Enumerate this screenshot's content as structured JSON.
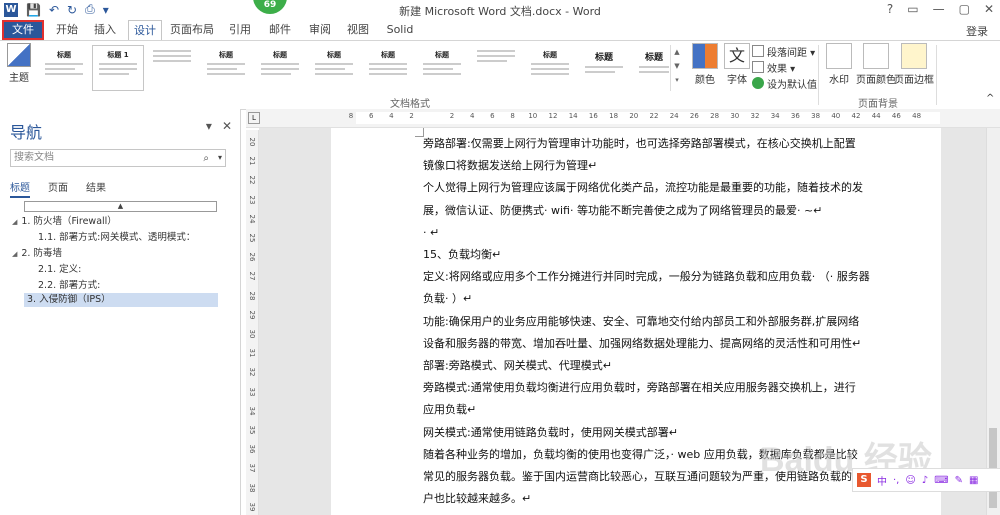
{
  "title": "新建 Microsoft Word 文档.docx - Word",
  "badge": "69",
  "login": "登录",
  "window_controls": [
    "?",
    "▭",
    "—",
    "▢",
    "✕"
  ],
  "tabs": [
    "文件",
    "开始",
    "插入",
    "设计",
    "页面布局",
    "引用",
    "邮件",
    "审阅",
    "视图",
    "Solid"
  ],
  "active_tab": "设计",
  "ribbon": {
    "theme_label": "主题",
    "gallery": [
      {
        "title": "标题"
      },
      {
        "title": "标题 1"
      },
      {
        "title": ""
      },
      {
        "title": "标题"
      },
      {
        "title": "标题"
      },
      {
        "title": "标题"
      },
      {
        "title": "标题"
      },
      {
        "title": "标题"
      },
      {
        "title": ""
      },
      {
        "title": "标题"
      },
      {
        "title": "标题"
      },
      {
        "title": "标题"
      }
    ],
    "colors_label": "颜色",
    "fonts_label": "字体",
    "paragraph_spacing": "段落间距",
    "effects": "效果",
    "set_default": "设为默认值",
    "group_doc_format": "文档格式",
    "watermark": "水印",
    "page_color": "页面颜色",
    "page_border": "页面边框",
    "group_page_bg": "页面背景"
  },
  "nav": {
    "title": "导航",
    "search_placeholder": "搜索文档",
    "tabs": [
      "标题",
      "页面",
      "结果"
    ],
    "items": [
      "1. 防火墙（Firewall）",
      "1.1. 部署方式:网关模式、透明模式：",
      "2. 防毒墙",
      "2.1. 定义:",
      "2.2. 部署方式:",
      "3. 入侵防御（IPS）"
    ]
  },
  "ruler": {
    "h_ticks": [
      "8",
      "6",
      "4",
      "2",
      "",
      "2",
      "4",
      "6",
      "8",
      "10",
      "12",
      "14",
      "16",
      "18",
      "20",
      "22",
      "24",
      "26",
      "28",
      "30",
      "32",
      "34",
      "36",
      "38",
      "40",
      "42",
      "44",
      "46",
      "48"
    ],
    "v_ticks": [
      "20",
      "21",
      "22",
      "23",
      "24",
      "25",
      "26",
      "27",
      "28",
      "29",
      "30",
      "31",
      "32",
      "33",
      "34",
      "35",
      "36",
      "37",
      "38",
      "39"
    ]
  },
  "document": [
    "旁路部署:仅需要上网行为管理审计功能时，也可选择旁路部署模式，在核心交换机上配置",
    "镜像口将数据发送给上网行为管理↵",
    "个人觉得上网行为管理应该属于网络优化类产品，流控功能是最重要的功能，随着技术的发",
    "展，微信认证、防便携式· wifi· 等功能不断完善使之成为了网络管理员的最爱· ~↵",
    "· ↵",
    "15、负载均衡↵",
    "定义:将网络或应用多个工作分摊进行并同时完成，一般分为链路负载和应用负载· （· 服务器",
    "负载· ）↵",
    "功能:确保用户的业务应用能够快速、安全、可靠地交付给内部员工和外部服务群,扩展网络",
    "设备和服务器的带宽、增加吞吐量、加强网络数据处理能力、提高网络的灵活性和可用性↵",
    "部署:旁路模式、网关模式、代理模式↵",
    "旁路模式:通常使用负载均衡进行应用负载时，旁路部署在相关应用服务器交换机上，进行",
    "应用负载↵",
    "网关模式:通常使用链路负载时，使用网关模式部署↵",
    "随着各种业务的增加，负载均衡的使用也变得广泛，· web 应用负载，数据库负载都是比较",
    "常见的服务器负载。鉴于国内运营商比较恶心，互联互通问题较为严重，使用链路负载的用",
    "户也比较越来越多。↵"
  ],
  "watermark_text": "Baidu 经验",
  "ime": {
    "logo": "S",
    "label": "中"
  }
}
